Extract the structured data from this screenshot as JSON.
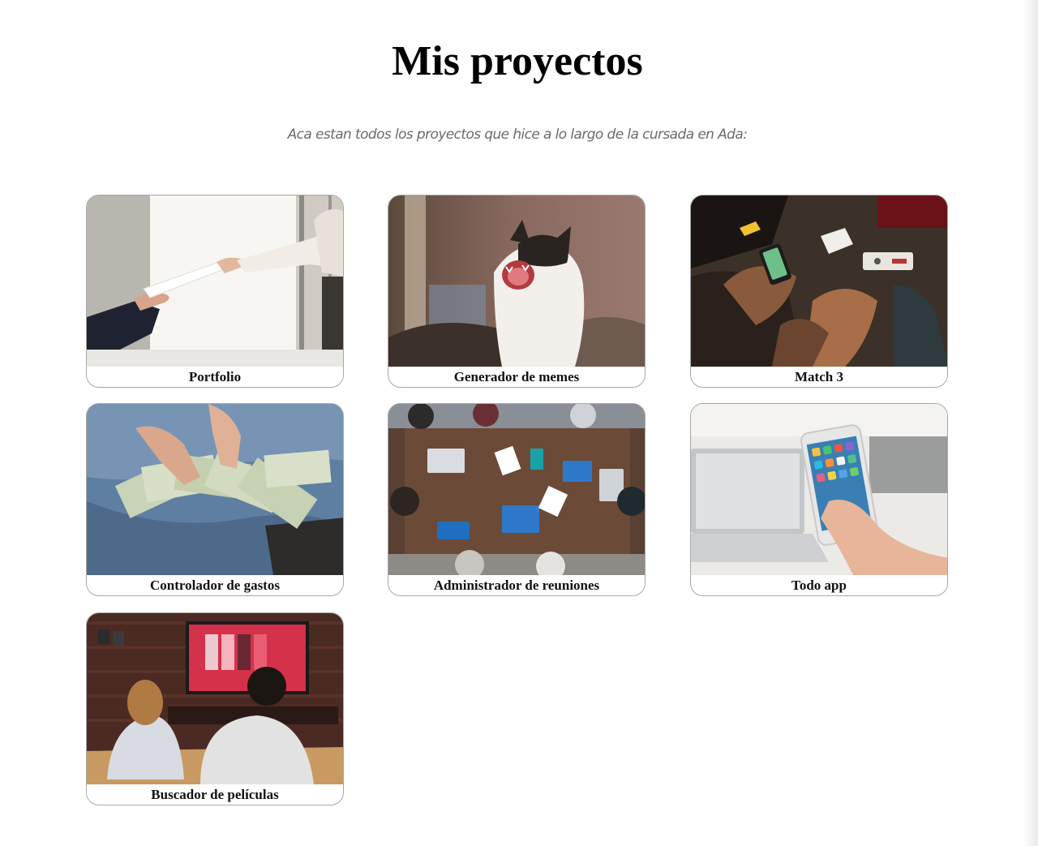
{
  "page": {
    "title": "Mis proyectos",
    "subtitle": "Aca estan todos los proyectos que hice a lo largo de la cursada en Ada:"
  },
  "projects": [
    {
      "name": "Portfolio",
      "image": "handshake-document-photo"
    },
    {
      "name": "Generador de memes",
      "image": "yawning-cat-photo"
    },
    {
      "name": "Match 3",
      "image": "people-gaming-phone-photo"
    },
    {
      "name": "Controlador de gastos",
      "image": "hands-counting-dollars-photo"
    },
    {
      "name": "Administrador de reuniones",
      "image": "team-meeting-table-photo"
    },
    {
      "name": "Todo app",
      "image": "hand-holding-smartphone-photo"
    },
    {
      "name": "Buscador de películas",
      "image": "couple-watching-tv-photo"
    }
  ]
}
